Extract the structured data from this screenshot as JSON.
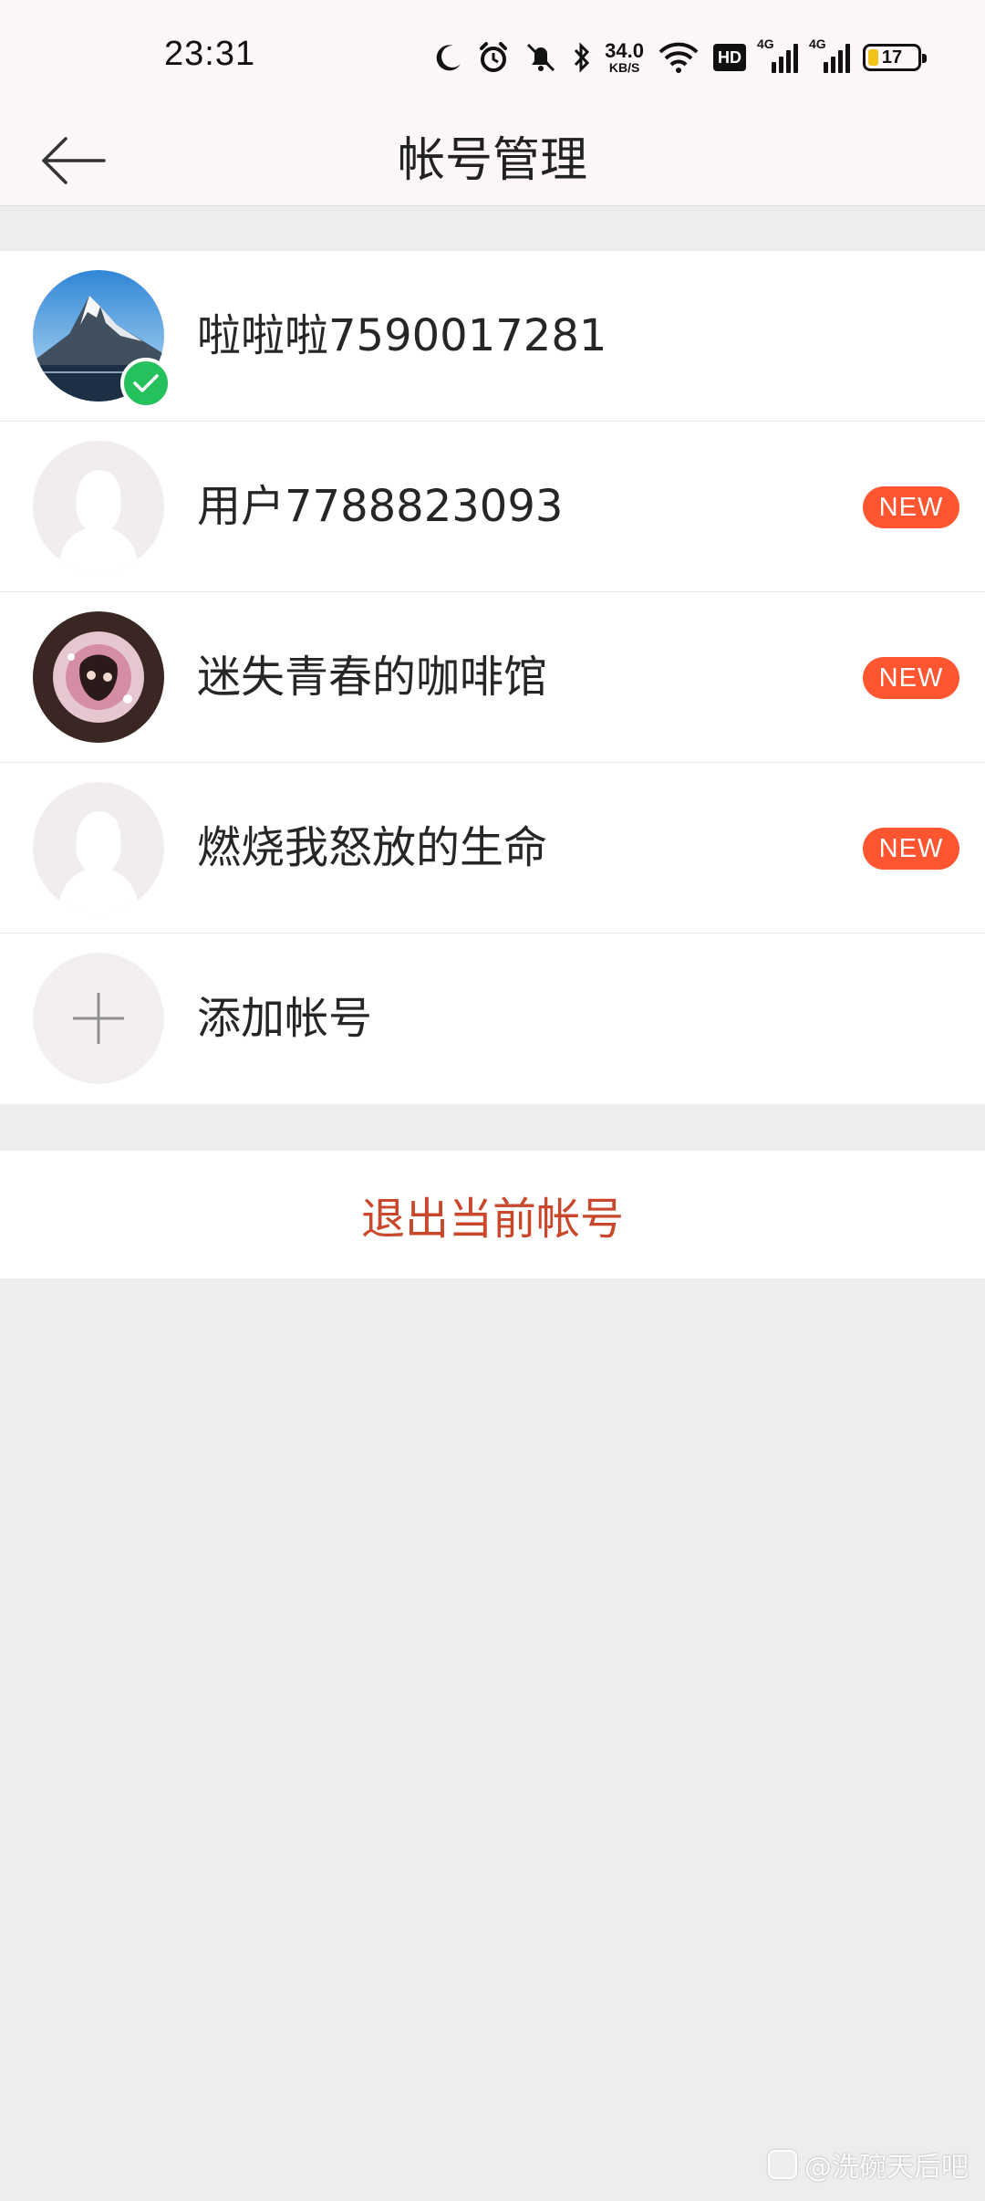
{
  "status_bar": {
    "time": "23:31",
    "net_speed_value": "34.0",
    "net_speed_unit": "KB/S",
    "hd_label": "HD",
    "signal_1_label": "4G",
    "signal_2_label": "4G",
    "battery_level": "17"
  },
  "header": {
    "title": "帐号管理",
    "back_icon": "arrow-left-icon"
  },
  "accounts": [
    {
      "name": "啦啦啦7590017281",
      "current": true,
      "badge": ""
    },
    {
      "name": "用户7788823093",
      "current": false,
      "badge": "NEW"
    },
    {
      "name": "迷失青春的咖啡馆",
      "current": false,
      "badge": "NEW"
    },
    {
      "name": "燃烧我怒放的生命",
      "current": false,
      "badge": "NEW"
    }
  ],
  "add_account": {
    "label": "添加帐号",
    "icon": "plus-icon"
  },
  "logout": {
    "label": "退出当前帐号"
  },
  "watermark": {
    "text": "@洗碗天后吧"
  },
  "colors": {
    "header_bg": "#fcf6fa",
    "page_bg": "#ededed",
    "new_badge": "#ff5631",
    "logout_text": "#c9472b",
    "check_badge": "#24c15c"
  }
}
